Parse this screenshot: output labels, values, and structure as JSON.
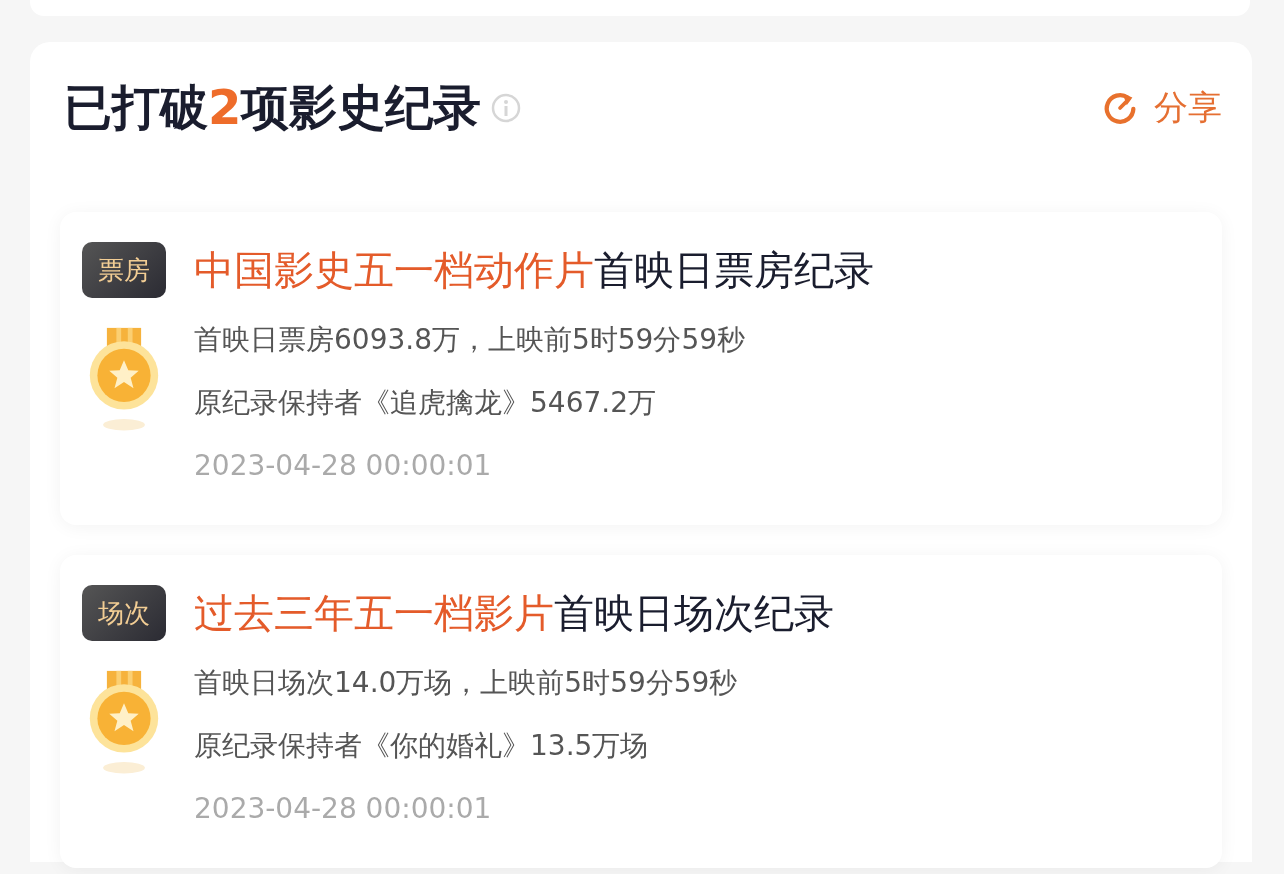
{
  "header": {
    "title_before": "已打破",
    "count": "2",
    "title_after": "项影史纪录",
    "share": "分享"
  },
  "records": [
    {
      "tag": "票房",
      "highlight": "中国影史五一档动作片",
      "title_rest": "首映日票房纪录",
      "lines": [
        "首映日票房6093.8万，上映前5时59分59秒",
        "原纪录保持者《追虎擒龙》5467.2万"
      ],
      "date": "2023-04-28 00:00:01"
    },
    {
      "tag": "场次",
      "highlight": "过去三年五一档影片",
      "title_rest": "首映日场次纪录",
      "lines": [
        "首映日场次14.0万场，上映前5时59分59秒",
        "原纪录保持者《你的婚礼》13.5万场"
      ],
      "date": "2023-04-28 00:00:01"
    }
  ]
}
